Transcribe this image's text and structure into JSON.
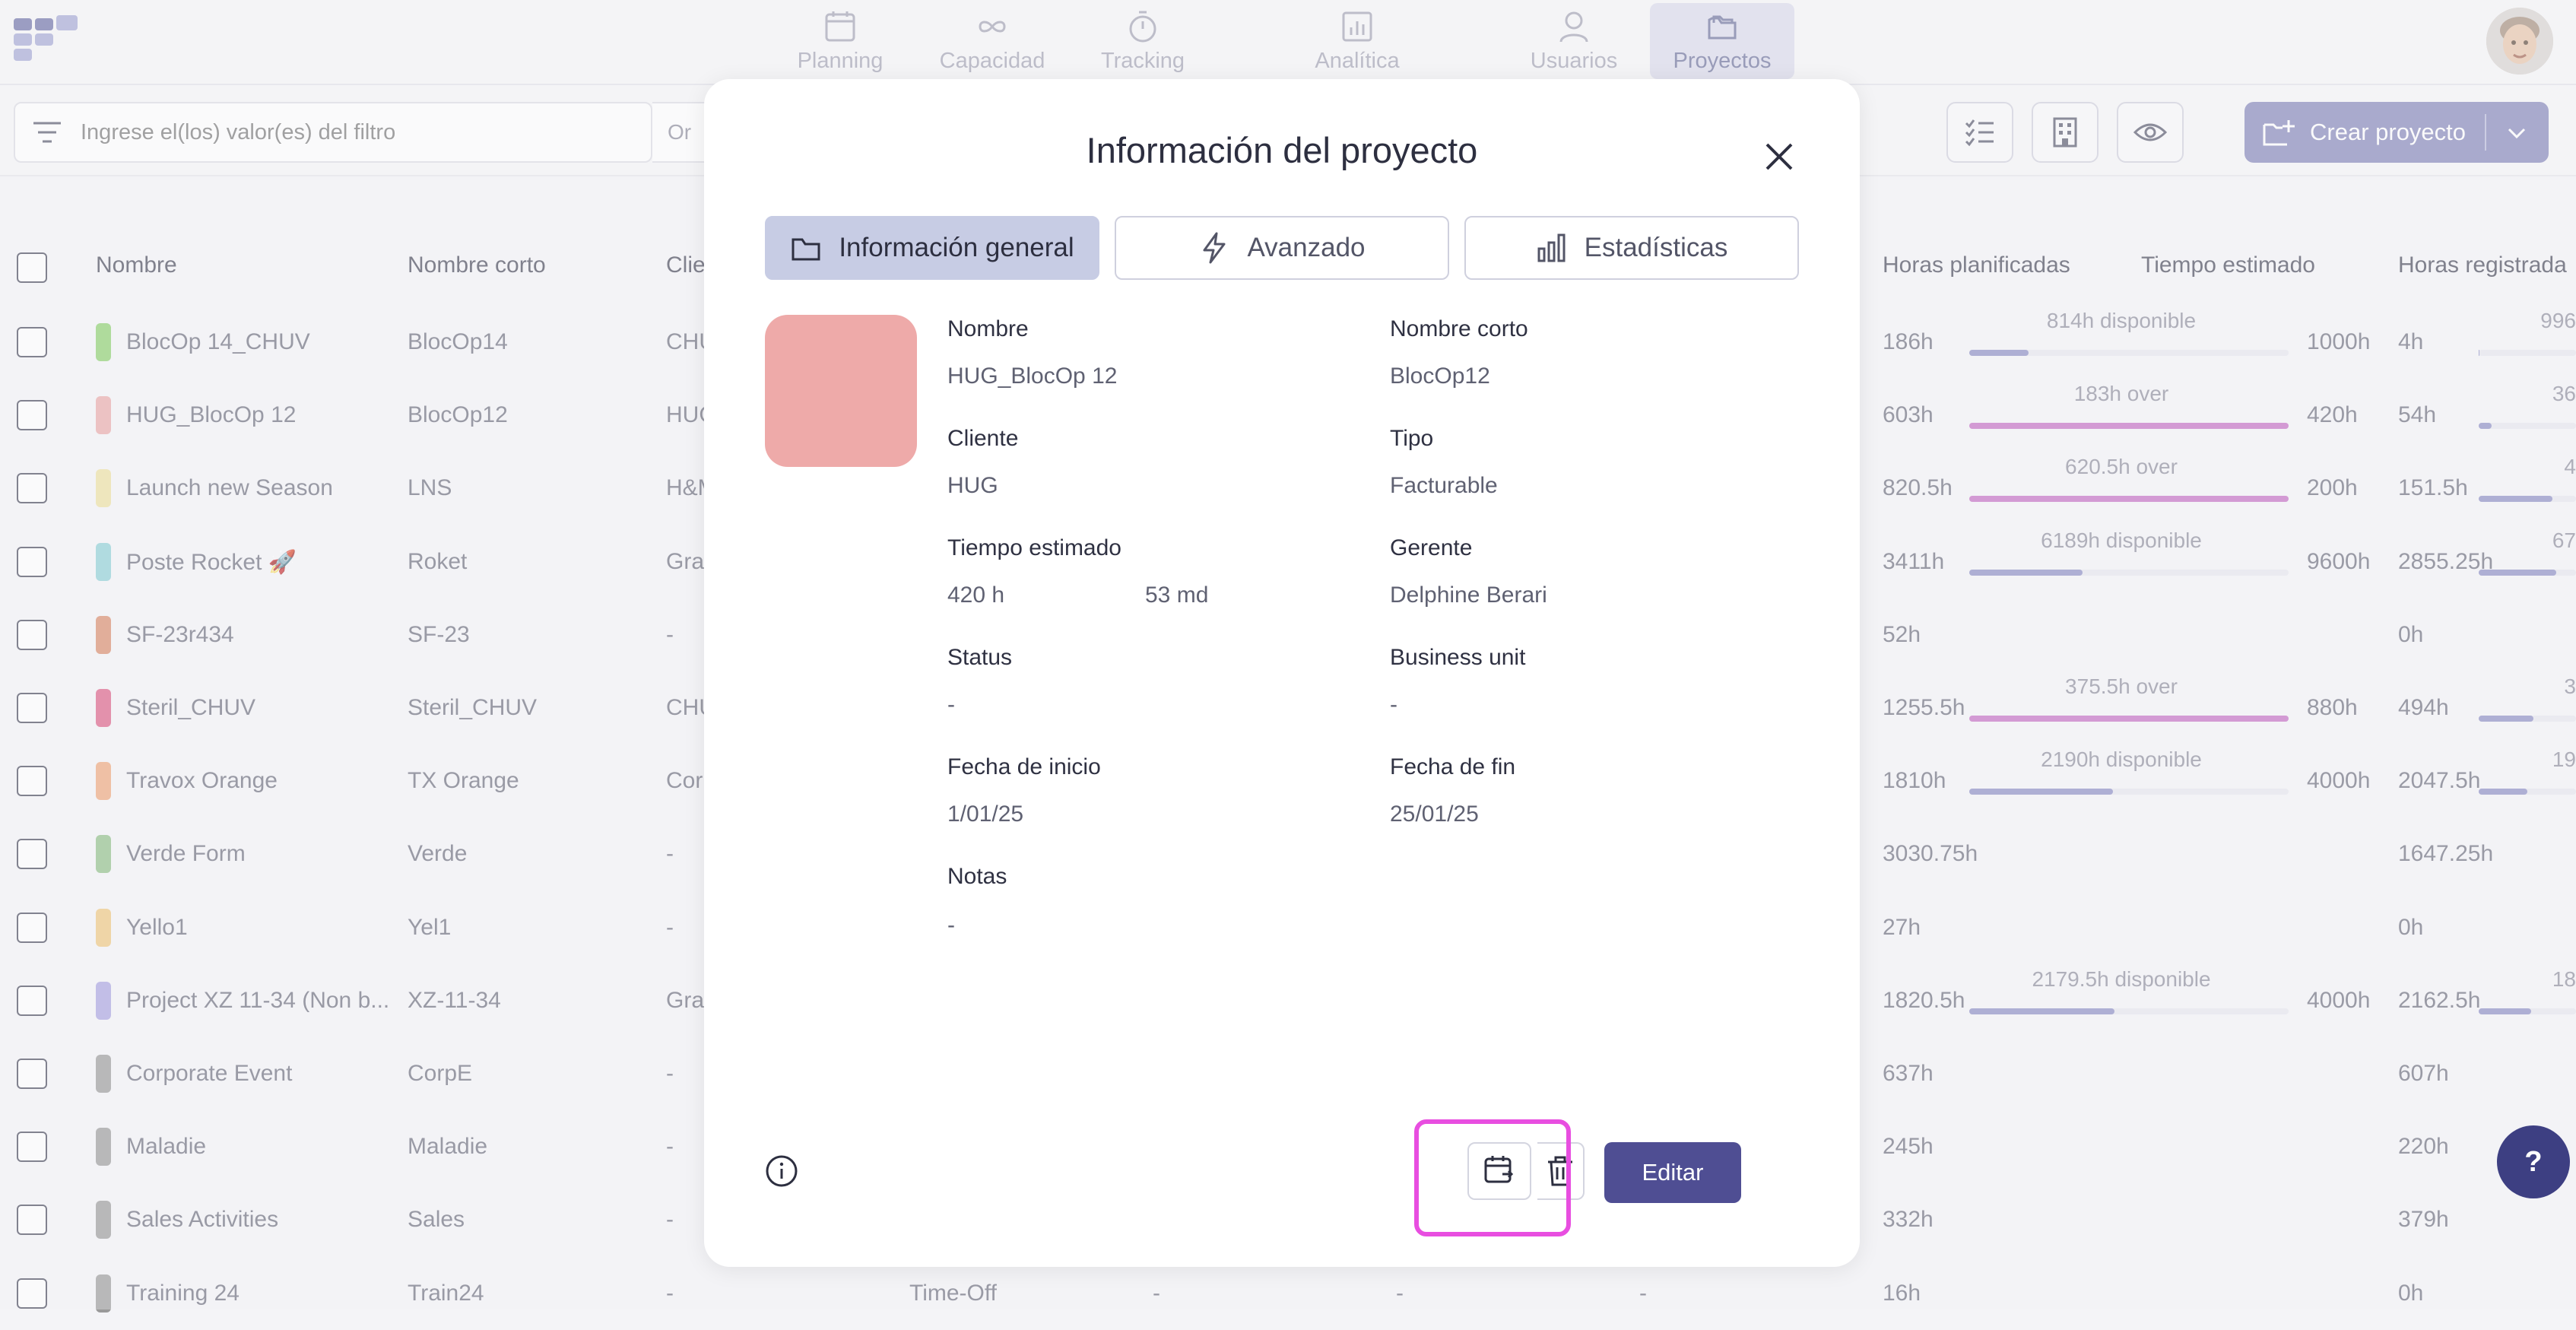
{
  "nav": {
    "items": [
      {
        "label": "Planning",
        "icon": "calendar-icon"
      },
      {
        "label": "Capacidad",
        "icon": "infinity-icon"
      },
      {
        "label": "Tracking",
        "icon": "stopwatch-icon"
      },
      {
        "label": "Analítica",
        "icon": "chart-icon"
      },
      {
        "label": "Usuarios",
        "icon": "user-icon"
      },
      {
        "label": "Proyectos",
        "icon": "folder-icon"
      }
    ],
    "active": "Proyectos"
  },
  "toolbar": {
    "filter_placeholder": "Ingrese el(los) valor(es) del filtro",
    "filter_operator": "Or",
    "create_label": "Crear proyecto"
  },
  "table": {
    "headers": {
      "name": "Nombre",
      "short": "Nombre corto",
      "client": "Clie",
      "planned": "Horas planificadas",
      "estimated": "Tiempo estimado",
      "registered": "Horas registrada"
    },
    "rows": [
      {
        "color": "#8ccf6e",
        "name": "BlocOp 14_CHUV",
        "short": "BlocOp14",
        "client": "CHU",
        "planned": "186h",
        "bar1_label": "814h disponible",
        "bar1_color": "#8a8cc4",
        "bar1_fill": 0.186,
        "estimated": "1000h",
        "registered": "4h",
        "bar2_label": "996",
        "bar2_fill": 0.004
      },
      {
        "color": "#eaaaaa",
        "name": "HUG_BlocOp 12",
        "short": "BlocOp12",
        "client": "HUG",
        "planned": "603h",
        "bar1_label": "183h over",
        "bar1_color": "#c36cc4",
        "bar1_fill": 1.0,
        "estimated": "420h",
        "registered": "54h",
        "bar2_label": "36",
        "bar2_fill": 0.13
      },
      {
        "color": "#ede1a0",
        "name": "Launch new Season",
        "short": "LNS",
        "client": "H&M",
        "planned": "820.5h",
        "bar1_label": "620.5h over",
        "bar1_color": "#c36cc4",
        "bar1_fill": 1.0,
        "estimated": "200h",
        "registered": "151.5h",
        "bar2_label": "4",
        "bar2_fill": 0.76
      },
      {
        "color": "#8ecfd6",
        "name": "Poste Rocket 🚀",
        "short": "Roket",
        "client": "Gra",
        "planned": "3411h",
        "bar1_label": "6189h disponible",
        "bar1_color": "#8a8cc4",
        "bar1_fill": 0.355,
        "estimated": "9600h",
        "registered": "2855.25h",
        "bar2_label": "67",
        "bar2_fill": 0.8
      },
      {
        "color": "#d98a6a",
        "name": "SF-23r434",
        "short": "SF-23",
        "client": "-",
        "planned": "52h",
        "bar1_label": "",
        "bar1_color": "",
        "bar1_fill": 0,
        "estimated": "",
        "registered": "0h",
        "bar2_label": "",
        "bar2_fill": 0
      },
      {
        "color": "#dc5f86",
        "name": "Steril_CHUV",
        "short": "Steril_CHUV",
        "client": "CHU",
        "planned": "1255.5h",
        "bar1_label": "375.5h over",
        "bar1_color": "#c36cc4",
        "bar1_fill": 1.0,
        "estimated": "880h",
        "registered": "494h",
        "bar2_label": "3",
        "bar2_fill": 0.56
      },
      {
        "color": "#eea77b",
        "name": "Travox Orange",
        "short": "TX Orange",
        "client": "Cor",
        "planned": "1810h",
        "bar1_label": "2190h disponible",
        "bar1_color": "#8a8cc4",
        "bar1_fill": 0.45,
        "estimated": "4000h",
        "registered": "2047.5h",
        "bar2_label": "19",
        "bar2_fill": 0.5
      },
      {
        "color": "#8fbf88",
        "name": "Verde Form",
        "short": "Verde",
        "client": "-",
        "planned": "3030.75h",
        "bar1_label": "",
        "bar1_color": "",
        "bar1_fill": 0,
        "estimated": "",
        "registered": "1647.25h",
        "bar2_label": "",
        "bar2_fill": 0
      },
      {
        "color": "#eec77e",
        "name": "Yello1",
        "short": "Yel1",
        "client": "-",
        "planned": "27h",
        "bar1_label": "",
        "bar1_color": "",
        "bar1_fill": 0,
        "estimated": "",
        "registered": "0h",
        "bar2_label": "",
        "bar2_fill": 0
      },
      {
        "color": "#a9a4e0",
        "name": "Project XZ 11-34 (Non b...",
        "short": "XZ-11-34",
        "client": "Gra",
        "planned": "1820.5h",
        "bar1_label": "2179.5h disponible",
        "bar1_color": "#8a8cc4",
        "bar1_fill": 0.455,
        "estimated": "4000h",
        "registered": "2162.5h",
        "bar2_label": "18",
        "bar2_fill": 0.54
      },
      {
        "color": "#9a9a9a",
        "name": "Corporate Event",
        "short": "CorpE",
        "client": "-",
        "planned": "637h",
        "bar1_label": "",
        "bar1_color": "",
        "bar1_fill": 0,
        "estimated": "",
        "registered": "607h",
        "bar2_label": "",
        "bar2_fill": 0
      },
      {
        "color": "#9a9a9a",
        "name": "Maladie",
        "short": "Maladie",
        "client": "-",
        "planned": "245h",
        "bar1_label": "",
        "bar1_color": "",
        "bar1_fill": 0,
        "estimated": "",
        "registered": "220h",
        "bar2_label": "",
        "bar2_fill": 0
      },
      {
        "color": "#9a9a9a",
        "name": "Sales Activities",
        "short": "Sales",
        "client": "-",
        "planned": "332h",
        "bar1_label": "",
        "bar1_color": "",
        "bar1_fill": 0,
        "estimated": "",
        "registered": "379h",
        "bar2_label": "",
        "bar2_fill": 0
      },
      {
        "color": "#9a9a9a",
        "name": "Training 24",
        "short": "Train24",
        "client": "-",
        "type": "Time-Off",
        "d1": "-",
        "d2": "-",
        "d3": "-",
        "planned": "16h",
        "bar1_label": "",
        "bar1_color": "",
        "bar1_fill": 0,
        "estimated": "",
        "registered": "0h",
        "bar2_label": "",
        "bar2_fill": 0
      }
    ]
  },
  "modal": {
    "title": "Información del proyecto",
    "tabs": [
      {
        "label": "Información general",
        "icon": "folder-icon"
      },
      {
        "label": "Avanzado",
        "icon": "lightning-icon"
      },
      {
        "label": "Estadísticas",
        "icon": "bar-chart-icon"
      }
    ],
    "color": "#eeaaa9",
    "fields": {
      "nombre_label": "Nombre",
      "nombre_value": "HUG_BlocOp 12",
      "nombre_corto_label": "Nombre corto",
      "nombre_corto_value": "BlocOp12",
      "cliente_label": "Cliente",
      "cliente_value": "HUG",
      "tipo_label": "Tipo",
      "tipo_value": "Facturable",
      "tiempo_label": "Tiempo estimado",
      "tiempo_hours": "420 h",
      "tiempo_days": "53 md",
      "gerente_label": "Gerente",
      "gerente_value": "Delphine Berari",
      "status_label": "Status",
      "status_value": "-",
      "bu_label": "Business unit",
      "bu_value": "-",
      "inicio_label": "Fecha de inicio",
      "inicio_value": "1/01/25",
      "fin_label": "Fecha de fin",
      "fin_value": "25/01/25",
      "notas_label": "Notas",
      "notas_value": "-"
    },
    "edit_label": "Editar"
  },
  "help_label": "?"
}
